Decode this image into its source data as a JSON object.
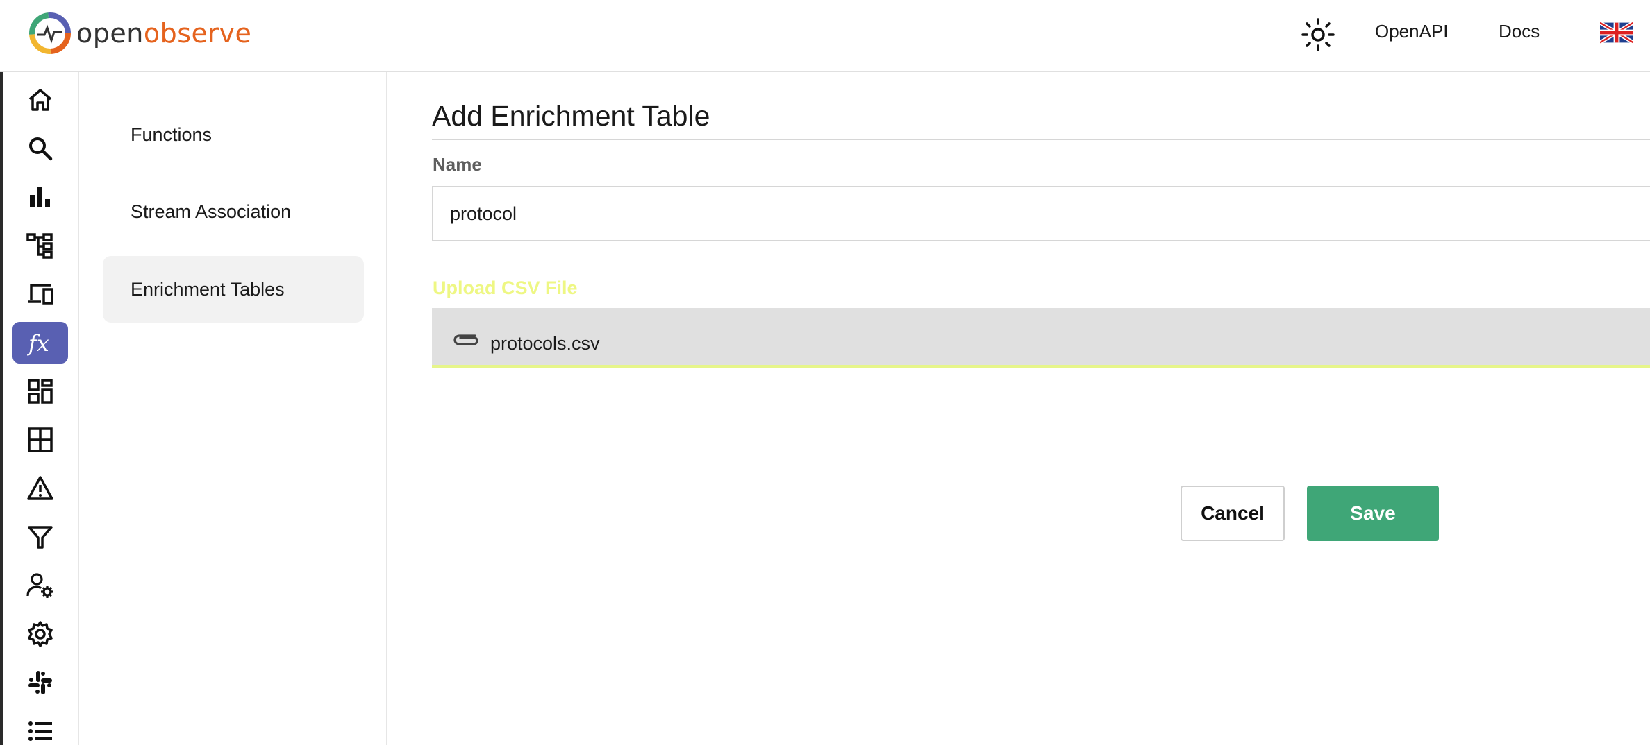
{
  "header": {
    "logo_text_open": "open",
    "logo_text_observe": "observe",
    "openapi_label": "OpenAPI",
    "docs_label": "Docs",
    "theme_icon": "sun-icon",
    "language_icon": "uk-flag-icon"
  },
  "rail": {
    "items": [
      {
        "name": "home",
        "icon": "home-icon"
      },
      {
        "name": "search",
        "icon": "search-icon"
      },
      {
        "name": "metrics",
        "icon": "bar-chart-icon"
      },
      {
        "name": "traces",
        "icon": "hierarchy-icon"
      },
      {
        "name": "rum",
        "icon": "devices-icon"
      },
      {
        "name": "functions",
        "icon": "fx-icon",
        "active": true
      },
      {
        "name": "dashboards",
        "icon": "dashboard-icon"
      },
      {
        "name": "streams",
        "icon": "grid-icon"
      },
      {
        "name": "alerts",
        "icon": "warning-icon"
      },
      {
        "name": "ingestion",
        "icon": "filter-icon"
      },
      {
        "name": "iam",
        "icon": "user-gear-icon"
      },
      {
        "name": "settings",
        "icon": "gear-icon"
      },
      {
        "name": "slack",
        "icon": "slack-icon"
      },
      {
        "name": "about",
        "icon": "list-icon"
      }
    ]
  },
  "submenu": {
    "items": [
      {
        "label": "Functions"
      },
      {
        "label": "Stream Association"
      },
      {
        "label": "Enrichment Tables",
        "active": true
      }
    ]
  },
  "form": {
    "title": "Add Enrichment Table",
    "name_label": "Name",
    "name_value": "protocol",
    "upload_label": "Upload CSV File",
    "file_name": "protocols.csv",
    "cancel_label": "Cancel",
    "save_label": "Save"
  },
  "colors": {
    "accent": "#5960b2",
    "save": "#3fa677",
    "upload_label": "#eef783",
    "brand_orange": "#e5631e"
  }
}
